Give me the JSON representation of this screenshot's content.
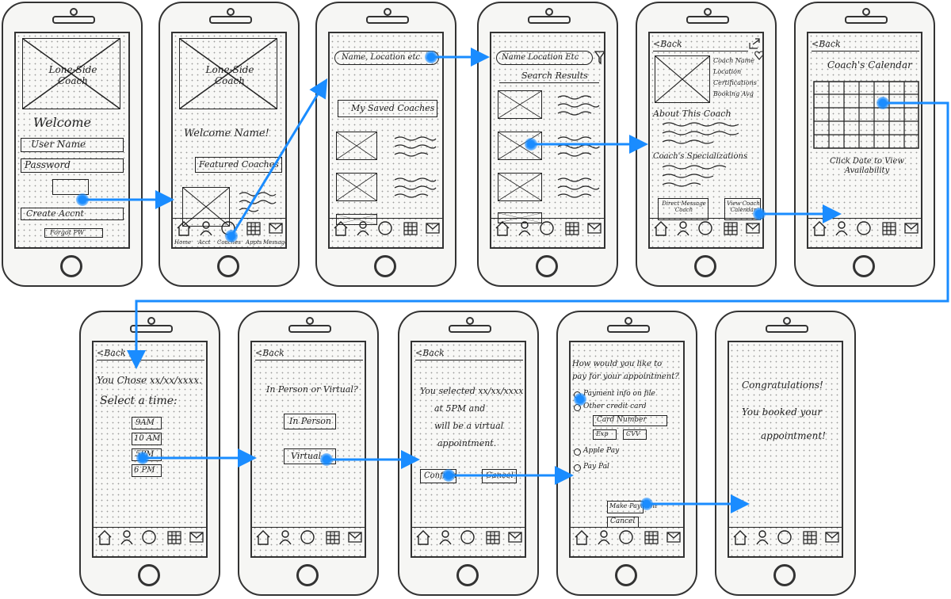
{
  "colors": {
    "arrow": "#1a8cff",
    "ink": "#222222",
    "phone_body": "#f6f6f4"
  },
  "nav": {
    "home": "Home",
    "acct": "Acct",
    "coaches": "Coaches",
    "appts": "Appts",
    "messages": "Messages"
  },
  "screens": {
    "login": {
      "logo": "Lone-Side Coach",
      "welcome": "Welcome",
      "username": "User Name",
      "password": "Password",
      "create_account": "Create Accnt",
      "forgot_pw": "Forgot PW"
    },
    "home": {
      "logo": "Lone-Side Coach",
      "welcome": "Welcome Name!",
      "featured": "Featured Coaches"
    },
    "coaches": {
      "search": "Name, Location etc",
      "saved": "My Saved Coaches"
    },
    "search_results": {
      "search": "Name Location Etc",
      "title": "Search Results"
    },
    "coach_profile": {
      "back": "Back",
      "info": [
        "Coach Name",
        "Location",
        "Certifications",
        "Booking Avg"
      ],
      "about": "About This Coach",
      "specializations": "Coach's Specializations",
      "direct_message": "Direct Message Coach",
      "view_calendar": "View Coach Calendar"
    },
    "calendar": {
      "back": "Back",
      "title": "Coach's Calendar",
      "hint": "Click Date to View Availability"
    },
    "select_time": {
      "back": "Back",
      "chose": "You Chose xx/xx/xxxx.",
      "select": "Select a time:",
      "times": [
        "9AM",
        "10 AM",
        "5PM",
        "6 PM"
      ]
    },
    "in_person_or_virtual": {
      "back": "Back",
      "question": "In Person or Virtual?",
      "in_person": "In Person",
      "virtual": "Virtual"
    },
    "confirm": {
      "back": "Back",
      "message": [
        "You selected xx/xx/xxxx",
        "at 5PM and",
        "will be a virtual",
        "appointment."
      ],
      "confirm": "Confirm",
      "cancel": "Cancel"
    },
    "payment": {
      "question": [
        "How would you like to",
        "pay for your appointment?"
      ],
      "options": [
        "Payment info on file",
        "Other credit card",
        "Apple Pay",
        "Pay Pal"
      ],
      "card_number": "Card Number",
      "exp": "Exp",
      "cvv": "CVV",
      "make_payment": "Make Payment",
      "cancel": "Cancel"
    },
    "success": {
      "line1": "Congratulations!",
      "line2": "You booked your",
      "line3": "appointment!"
    }
  }
}
